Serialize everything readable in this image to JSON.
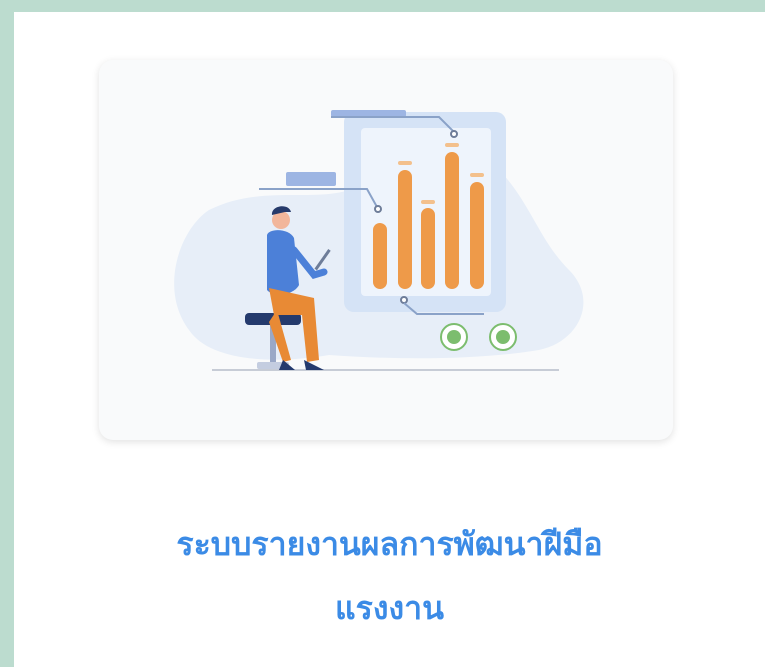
{
  "card": {
    "title_line1": "ระบบรายงานผลการพัฒนาฝีมือ",
    "title_line2": "แรงงาน",
    "illustration": "person-with-laptop-bar-chart-illustration"
  },
  "colors": {
    "background": "#bcdccf",
    "title": "#3b8be6",
    "bars": "#ee9a49",
    "blob": "#e7eef8"
  }
}
